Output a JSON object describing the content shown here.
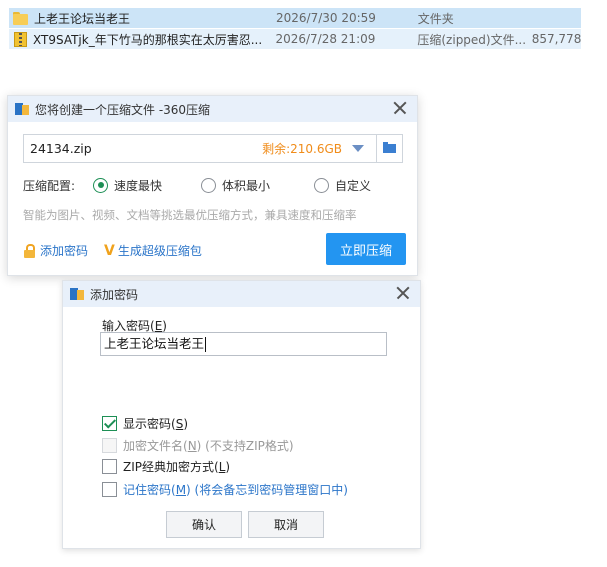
{
  "files": [
    {
      "name": "上老王论坛当老王",
      "date": "2026/7/30 20:59",
      "type": "文件夹",
      "size": "",
      "icon": "folder-icon"
    },
    {
      "name": "XT9SATjk_年下竹马的那根实在太厉害忍...",
      "date": "2026/7/28 21:09",
      "type": "压缩(zipped)文件...",
      "size": "857,778",
      "icon": "zip-file-icon"
    }
  ],
  "compress_dialog": {
    "title": "您将创建一个压缩文件 -360压缩",
    "filename": "24134.zip",
    "free_space": "剩余:210.6GB",
    "config_label": "压缩配置:",
    "options": [
      "速度最快",
      "体积最小",
      "自定义"
    ],
    "selected_option": "速度最快",
    "hint": "智能为图片、视频、文档等挑选最优压缩方式，兼具速度和压缩率",
    "add_password_link": "添加密码",
    "super_package_link": "生成超级压缩包",
    "compress_button": "立即压缩",
    "accent_color": "#2395f1"
  },
  "password_dialog": {
    "title": "添加密码",
    "input_label_prefix": "输入密码(",
    "input_label_key": "E",
    "input_label_suffix": ")",
    "password_value": "上老王论坛当老王",
    "show_password": {
      "label": "显示密码(",
      "key": "S",
      "suffix": ")",
      "checked": true
    },
    "encrypt_filenames": {
      "label": "加密文件名(",
      "key": "N",
      "suffix": ") (不支持ZIP格式)",
      "checked": false,
      "disabled": true
    },
    "zip_classic": {
      "label": "ZIP经典加密方式(",
      "key": "L",
      "suffix": ")",
      "checked": false
    },
    "remember_password": {
      "label": "记住密码(",
      "key": "M",
      "suffix": ") (将会备忘到密码管理窗口中)",
      "checked": false
    },
    "ok_button": "确认",
    "cancel_button": "取消"
  }
}
